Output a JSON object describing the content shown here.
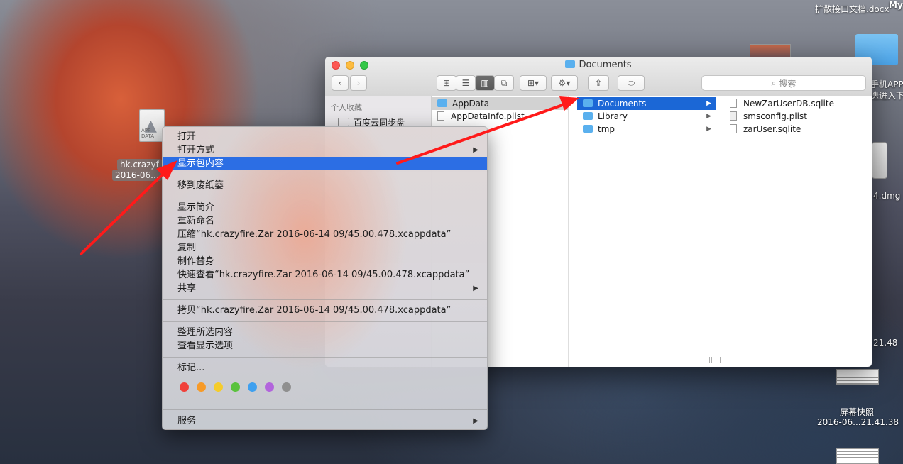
{
  "desktop": {
    "top_right_file": "扩散接口文档.docx",
    "top_right_file_2": "My",
    "right_label_1": "手机APP",
    "right_label_2": "迭进入下",
    "right_dmg": "4.dmg",
    "right_time_1": "21.48",
    "screenshot_title": "屏幕快照",
    "screenshot_time": "2016-06...21.41.38",
    "selected_file_line1": "hk.crazyf",
    "selected_file_line2": "2016-06...",
    "file_icon_text": "APP DATA"
  },
  "finder": {
    "title": "Documents",
    "search_placeholder": "搜索",
    "sidebar": {
      "header": "个人收藏",
      "items": [
        {
          "label": "百度云同步盘"
        }
      ]
    },
    "col1": [
      {
        "label": "AppData",
        "type": "folder"
      },
      {
        "label": "AppDataInfo.plist",
        "type": "plist"
      }
    ],
    "col2": [
      {
        "label": "Documents"
      },
      {
        "label": "Library"
      },
      {
        "label": "tmp"
      }
    ],
    "col3": [
      {
        "label": "NewZarUserDB.sqlite"
      },
      {
        "label": "smsconfig.plist"
      },
      {
        "label": "zarUser.sqlite"
      }
    ]
  },
  "menu": {
    "open": "打开",
    "open_with": "打开方式",
    "show_package": "显示包内容",
    "trash": "移到废纸篓",
    "get_info": "显示简介",
    "rename": "重新命名",
    "compress": "压缩“hk.crazyfire.Zar 2016-06-14 09/45.00.478.xcappdata”",
    "duplicate": "复制",
    "alias": "制作替身",
    "quicklook": "快速查看“hk.crazyfire.Zar 2016-06-14 09/45.00.478.xcappdata”",
    "share": "共享",
    "copy": "拷贝“hk.crazyfire.Zar 2016-06-14 09/45.00.478.xcappdata”",
    "clean_up": "整理所选内容",
    "view_options": "查看显示选项",
    "tags": "标记...",
    "services": "服务",
    "tag_colors": [
      "#f0403a",
      "#f79a27",
      "#f5cc2a",
      "#5ac23d",
      "#3fa0ef",
      "#b264dc",
      "#8f8f8f"
    ]
  },
  "colors": {
    "selection": "#1b67d6",
    "menu_highlight": "#2c6ee4",
    "arrow": "#ff1a1a"
  }
}
